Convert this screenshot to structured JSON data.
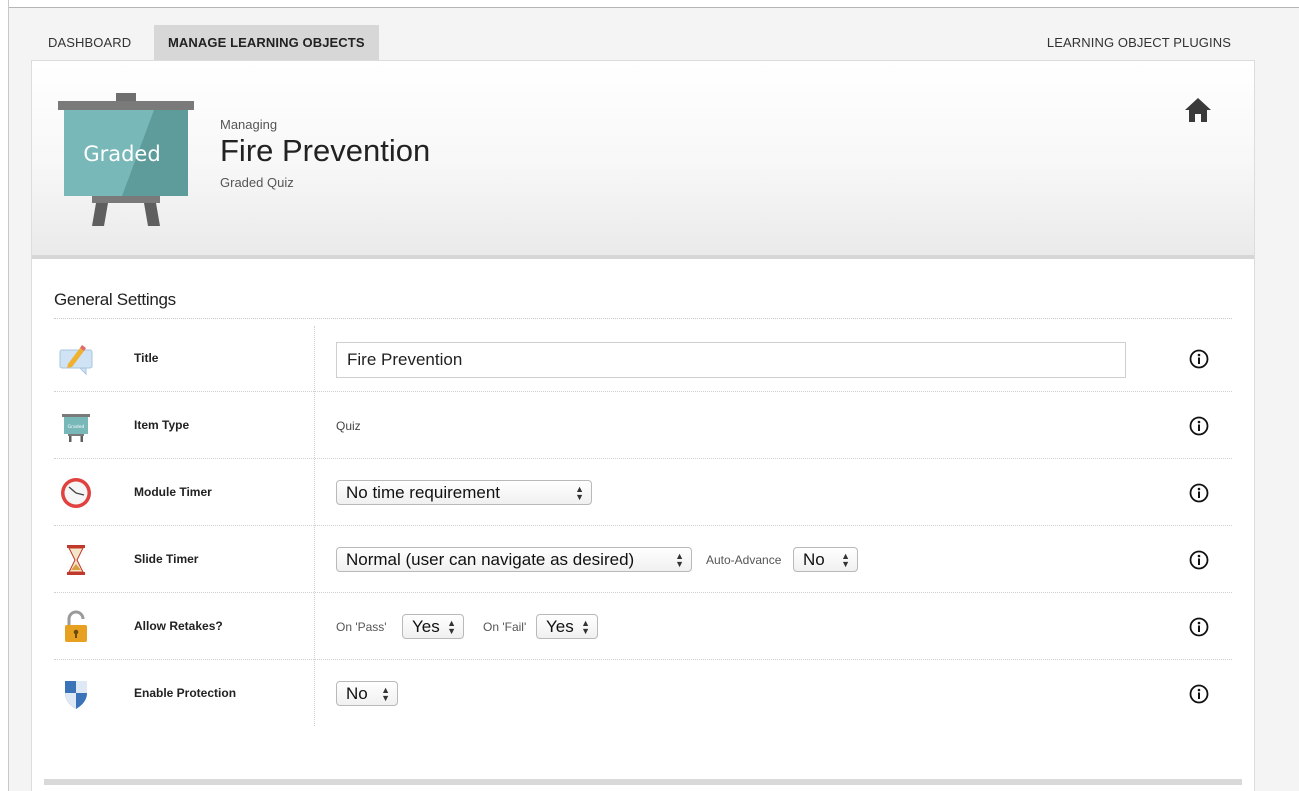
{
  "nav": {
    "tabs": [
      {
        "label": "DASHBOARD"
      },
      {
        "label": "MANAGE LEARNING OBJECTS"
      }
    ],
    "plugins_label": "LEARNING OBJECT PLUGINS"
  },
  "header": {
    "badge_text": "Graded",
    "managing_label": "Managing",
    "item_name": "Fire Prevention",
    "item_type": "Graded Quiz"
  },
  "section": {
    "title": "General Settings"
  },
  "rows": {
    "title": {
      "label": "Title",
      "value": "Fire Prevention",
      "icon": "pencil-speech-icon"
    },
    "item_type": {
      "label": "Item Type",
      "value": "Quiz",
      "icon": "easel-icon"
    },
    "module_timer": {
      "label": "Module Timer",
      "selected": "No time requirement",
      "icon": "clock-icon"
    },
    "slide_timer": {
      "label": "Slide Timer",
      "selected": "Normal (user can navigate as desired)",
      "auto_advance_label": "Auto-Advance",
      "auto_advance_selected": "No",
      "icon": "hourglass-icon"
    },
    "retakes": {
      "label": "Allow Retakes?",
      "on_pass_label": "On 'Pass'",
      "on_pass_selected": "Yes",
      "on_fail_label": "On 'Fail'",
      "on_fail_selected": "Yes",
      "icon": "padlock-icon"
    },
    "protection": {
      "label": "Enable Protection",
      "selected": "No",
      "icon": "shield-icon"
    }
  },
  "colors": {
    "easel_board": "#78b8b8",
    "selected_tab": "#d7d7d7",
    "clock_red": "#e0423f",
    "shield_blue": "#3a73b8",
    "padlock_gold": "#e8a020"
  }
}
